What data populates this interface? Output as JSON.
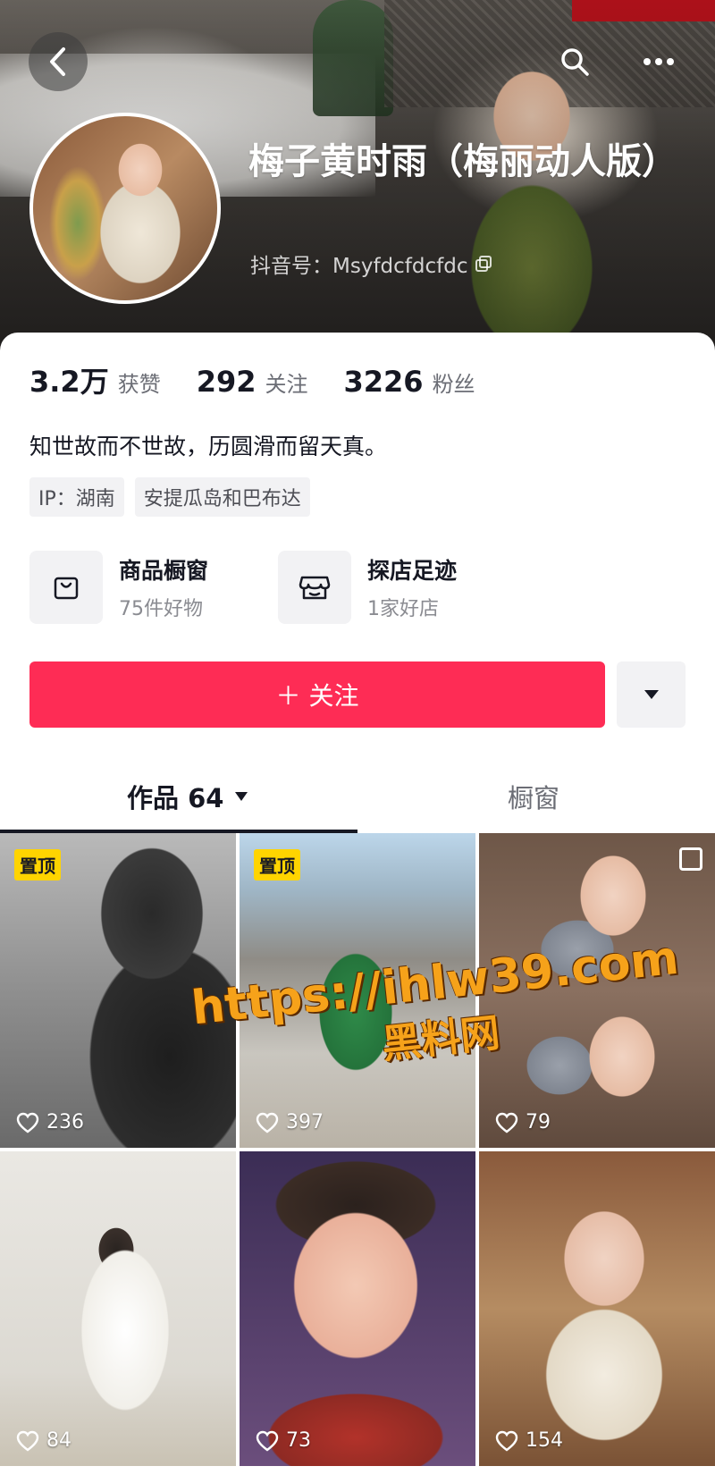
{
  "header": {
    "name": "梅子黄时雨（梅丽动人版）",
    "douyin_id": "抖音号：Msyfdcfdcfdc"
  },
  "stats": [
    {
      "value": "3.2万",
      "label": "获赞"
    },
    {
      "value": "292",
      "label": "关注"
    },
    {
      "value": "3226",
      "label": "粉丝"
    }
  ],
  "bio": "知世故而不世故，历圆滑而留天真。",
  "tags": [
    "IP：湖南",
    "安提瓜岛和巴布达"
  ],
  "features": [
    {
      "title": "商品橱窗",
      "subtitle": "75件好物",
      "icon": "shopping-bag-icon"
    },
    {
      "title": "探店足迹",
      "subtitle": "1家好店",
      "icon": "storefront-icon"
    }
  ],
  "actions": {
    "follow_label": "＋ 关注"
  },
  "tabs": {
    "works_label": "作品 64",
    "shop_label": "橱窗"
  },
  "videos": [
    {
      "likes": "236",
      "pinned": "置顶"
    },
    {
      "likes": "397",
      "pinned": "置顶"
    },
    {
      "likes": "79"
    },
    {
      "likes": "84"
    },
    {
      "likes": "73"
    },
    {
      "likes": "154"
    }
  ],
  "watermark": {
    "line1": "https://ihlw39.com",
    "line2": "黑料网"
  },
  "colors": {
    "accent": "#fe2c55",
    "pin_badge": "#ffd400"
  }
}
